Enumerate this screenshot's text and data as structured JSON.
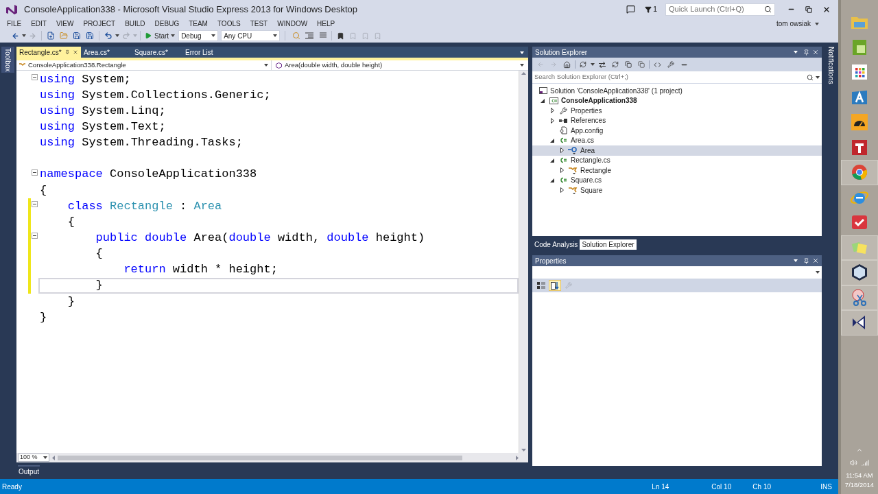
{
  "window": {
    "title": "ConsoleApplication338 - Microsoft Visual Studio Express 2013 for Windows Desktop",
    "notification_count": "1",
    "quick_launch": {
      "placeholder": "Quick Launch (Ctrl+Q)"
    },
    "user": "tom owsiak"
  },
  "menu": [
    "FILE",
    "EDIT",
    "VIEW",
    "PROJECT",
    "BUILD",
    "DEBUG",
    "TEAM",
    "TOOLS",
    "TEST",
    "WINDOW",
    "HELP"
  ],
  "toolbar": {
    "back": {
      "disabled": false
    },
    "forward": {
      "disabled": true
    },
    "undo": {
      "disabled": false
    },
    "redo": {
      "disabled": true
    },
    "start": "Start",
    "configuration": "Debug",
    "platform": "Any CPU",
    "bookmark_nav": [
      {
        "disabled": true
      },
      {
        "disabled": true
      },
      {
        "disabled": true
      }
    ]
  },
  "side_tabs": {
    "left": "Toolbox",
    "right": "Notifications"
  },
  "editor": {
    "tabs": [
      {
        "label": "Rectangle.cs*",
        "selected": true
      },
      {
        "label": "Area.cs*",
        "selected": false
      },
      {
        "label": "Square.cs*",
        "selected": false
      },
      {
        "label": "Error List",
        "selected": false
      }
    ],
    "type_dropdown": "ConsoleApplication338.Rectangle",
    "member_dropdown": "Area(double width, double height)",
    "lines": [
      {
        "tokens": [
          {
            "text": "using",
            "kind": "keyword"
          },
          {
            "text": " System;",
            "kind": "plain"
          }
        ],
        "collapsible": true,
        "modified": false,
        "current": false
      },
      {
        "tokens": [
          {
            "text": "using",
            "kind": "keyword"
          },
          {
            "text": " System.Collections.Generic;",
            "kind": "plain"
          }
        ],
        "collapsible": false,
        "modified": false,
        "current": false
      },
      {
        "tokens": [
          {
            "text": "using",
            "kind": "keyword"
          },
          {
            "text": " System.Linq;",
            "kind": "plain"
          }
        ],
        "collapsible": false,
        "modified": false,
        "current": false
      },
      {
        "tokens": [
          {
            "text": "using",
            "kind": "keyword"
          },
          {
            "text": " System.Text;",
            "kind": "plain"
          }
        ],
        "collapsible": false,
        "modified": false,
        "current": false
      },
      {
        "tokens": [
          {
            "text": "using",
            "kind": "keyword"
          },
          {
            "text": " System.Threading.Tasks;",
            "kind": "plain"
          }
        ],
        "collapsible": false,
        "modified": false,
        "current": false
      },
      {
        "collapsible": false,
        "modified": false,
        "current": false
      },
      {
        "tokens": [
          {
            "text": "namespace",
            "kind": "keyword"
          },
          {
            "text": " ConsoleApplication338",
            "kind": "plain"
          }
        ],
        "collapsible": true,
        "modified": false,
        "current": false
      },
      {
        "tokens": [
          {
            "text": "{",
            "kind": "plain"
          }
        ],
        "collapsible": false,
        "modified": false,
        "current": false
      },
      {
        "tokens": [
          {
            "text": "    class",
            "kind": "keyword"
          },
          {
            "text": " Rectangle",
            "kind": "type"
          },
          {
            "text": " : ",
            "kind": "plain"
          },
          {
            "text": "Area",
            "kind": "type"
          }
        ],
        "collapsible": true,
        "modified": true,
        "current": false
      },
      {
        "tokens": [
          {
            "text": "    {",
            "kind": "plain"
          }
        ],
        "collapsible": false,
        "modified": true,
        "current": false
      },
      {
        "tokens": [
          {
            "text": "        public double",
            "kind": "keyword"
          },
          {
            "text": " Area(",
            "kind": "plain"
          },
          {
            "text": "double",
            "kind": "keyword"
          },
          {
            "text": " width, ",
            "kind": "plain"
          },
          {
            "text": "double",
            "kind": "keyword"
          },
          {
            "text": " height)",
            "kind": "plain"
          }
        ],
        "collapsible": true,
        "modified": true,
        "current": false
      },
      {
        "tokens": [
          {
            "text": "        {",
            "kind": "plain"
          }
        ],
        "collapsible": false,
        "modified": true,
        "current": false
      },
      {
        "tokens": [
          {
            "text": "            return",
            "kind": "keyword"
          },
          {
            "text": " width * height;",
            "kind": "plain"
          }
        ],
        "collapsible": false,
        "modified": true,
        "current": false
      },
      {
        "tokens": [
          {
            "text": "        }",
            "kind": "plain"
          }
        ],
        "collapsible": false,
        "modified": true,
        "current": true
      },
      {
        "tokens": [
          {
            "text": "    }",
            "kind": "plain"
          }
        ],
        "collapsible": false,
        "modified": false,
        "current": false
      },
      {
        "tokens": [
          {
            "text": "}",
            "kind": "plain"
          }
        ],
        "collapsible": false,
        "modified": false,
        "current": false
      }
    ],
    "zoom": "100 %"
  },
  "output_tab": "Output",
  "solution_explorer": {
    "title": "Solution Explorer",
    "nav": [
      {
        "disabled": true
      },
      {
        "disabled": true
      }
    ],
    "search": {
      "placeholder": "Search Solution Explorer (Ctrl+;)"
    },
    "solution": "Solution 'ConsoleApplication338' (1 project)",
    "tree": [
      {
        "label": "ConsoleApplication338",
        "kind": "project",
        "expanded": true,
        "selected": false,
        "children": [
          {
            "label": "Properties",
            "kind": "properties",
            "expanded": false,
            "selected": false
          },
          {
            "label": "References",
            "kind": "references",
            "expanded": false,
            "selected": false
          },
          {
            "label": "App.config",
            "kind": "config",
            "selected": false
          },
          {
            "label": "Area.cs",
            "kind": "csfile",
            "expanded": true,
            "selected": false,
            "children": [
              {
                "label": "Area",
                "kind": "interface",
                "expanded": false,
                "selected": true
              }
            ]
          },
          {
            "label": "Rectangle.cs",
            "kind": "csfile",
            "expanded": true,
            "selected": false,
            "children": [
              {
                "label": "Rectangle",
                "kind": "class",
                "expanded": false,
                "selected": false
              }
            ]
          },
          {
            "label": "Square.cs",
            "kind": "csfile",
            "expanded": true,
            "selected": false,
            "children": [
              {
                "label": "Square",
                "kind": "class",
                "expanded": false,
                "selected": false
              }
            ]
          }
        ]
      }
    ],
    "bottom_tabs": [
      {
        "label": "Code Analysis",
        "selected": false
      },
      {
        "label": "Solution Explorer",
        "selected": true
      }
    ]
  },
  "properties": {
    "title": "Properties",
    "tools": [
      {
        "kind": "categorized",
        "selected": false,
        "disabled": false
      },
      {
        "kind": "alphabetical",
        "selected": true,
        "disabled": false
      },
      {
        "kind": "pages",
        "selected": false,
        "disabled": true
      }
    ]
  },
  "status_bar": {
    "message": "Ready",
    "line": "Ln 14",
    "column": "Col 10",
    "char": "Ch 10",
    "mode": "INS"
  },
  "taskbar": {
    "apps": [
      {
        "kind": "folder",
        "running": false
      },
      {
        "kind": "sheet",
        "running": false
      },
      {
        "kind": "tiles",
        "running": false
      },
      {
        "kind": "letter",
        "running": false
      },
      {
        "kind": "gauge",
        "running": false
      },
      {
        "kind": "block",
        "running": false
      },
      {
        "kind": "browser",
        "running": true
      },
      {
        "kind": "globe",
        "running": false
      },
      {
        "kind": "tasks",
        "running": false
      },
      {
        "kind": "notes",
        "running": true
      },
      {
        "kind": "cube",
        "running": true
      },
      {
        "kind": "scissors",
        "running": true
      },
      {
        "kind": "studio",
        "running": true
      }
    ],
    "time": "11:54 AM",
    "date": "7/18/2014"
  }
}
